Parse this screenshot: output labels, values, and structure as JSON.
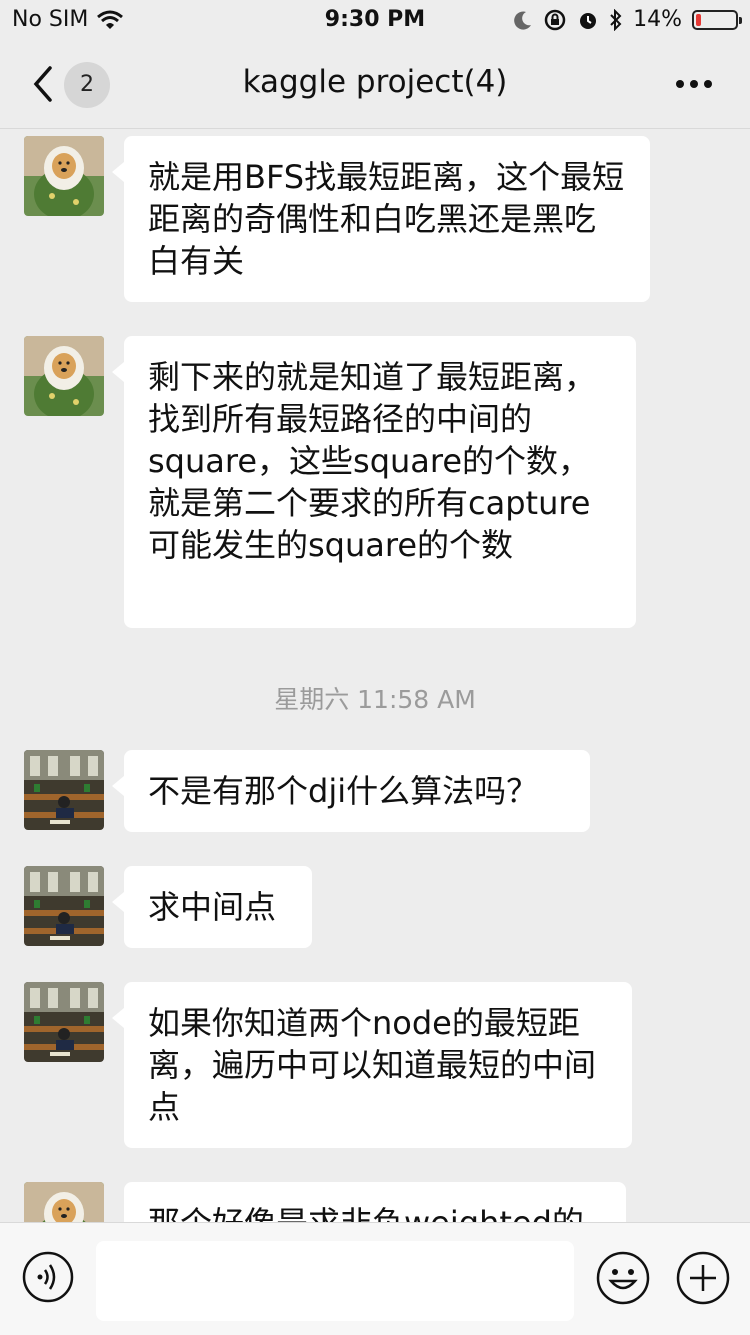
{
  "status_bar": {
    "carrier": "No SIM",
    "time": "9:30 PM",
    "battery_percent": "14%",
    "battery_level": 0.14,
    "battery_color": "#e53935"
  },
  "nav": {
    "back_icon": "chevron-left-icon",
    "unread_count": "2",
    "title": "kaggle project(4)",
    "more_icon": "more-dots-icon"
  },
  "messages": [
    {
      "text": "就是用BFS找最短距离，这个最短距离的奇偶性和白吃黑还是黑吃白有关"
    },
    {
      "text": "剩下来的就是知道了最短距离，找到所有最短路径的中间的square，这些square的个数，就是第二个要求的所有capture可能发生的square的个数"
    },
    {
      "text": "不是有那个dji什么算法吗？"
    },
    {
      "text": "求中间点"
    },
    {
      "text": "如果你知道两个node的最短距离，遍历中可以知道最短的中间点"
    },
    {
      "text": "那个好像是求非负weighted的"
    }
  ],
  "timestamp": "星期六 11:58 AM",
  "input_bar": {
    "voice_icon": "voice-icon",
    "emoji_icon": "emoji-icon",
    "plus_icon": "plus-icon",
    "input_value": ""
  }
}
